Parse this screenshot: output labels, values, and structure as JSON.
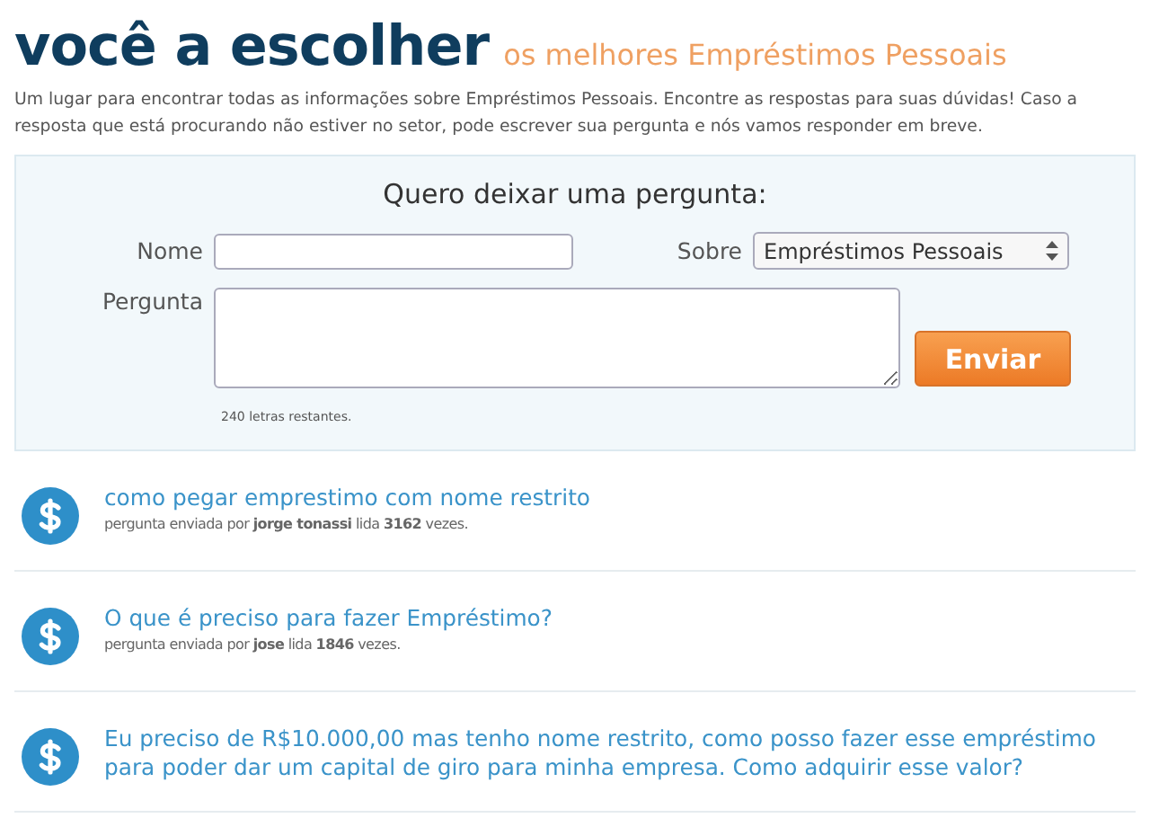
{
  "header": {
    "title": "você a escolher",
    "subtitle": "os melhores Empréstimos Pessoais",
    "intro": "Um lugar para encontrar todas as informações sobre Empréstimos Pessoais. Encontre as respostas para suas dúvidas! Caso a resposta que está procurando não estiver no setor, pode escrever sua pergunta e nós vamos responder em breve."
  },
  "form": {
    "heading": "Quero deixar uma pergunta:",
    "name_label": "Nome",
    "topic_label": "Sobre",
    "topic_value": "Empréstimos Pessoais",
    "question_label": "Pergunta",
    "submit": "Enviar",
    "counter": "240 letras restantes."
  },
  "questions": [
    {
      "title": "como pegar emprestimo com nome restrito",
      "meta": "pergunta enviada por **jorge tonassi** lida **3162** vezes."
    },
    {
      "title": "O que é preciso para fazer Empréstimo?",
      "meta": "pergunta enviada por **jose** lida **1846** vezes."
    },
    {
      "title": "Eu preciso de R$10.000,00 mas tenho nome restrito, como posso fazer esse empréstimo para poder dar um capital de giro para minha empresa. Como adquirir esse valor?"
    }
  ]
}
